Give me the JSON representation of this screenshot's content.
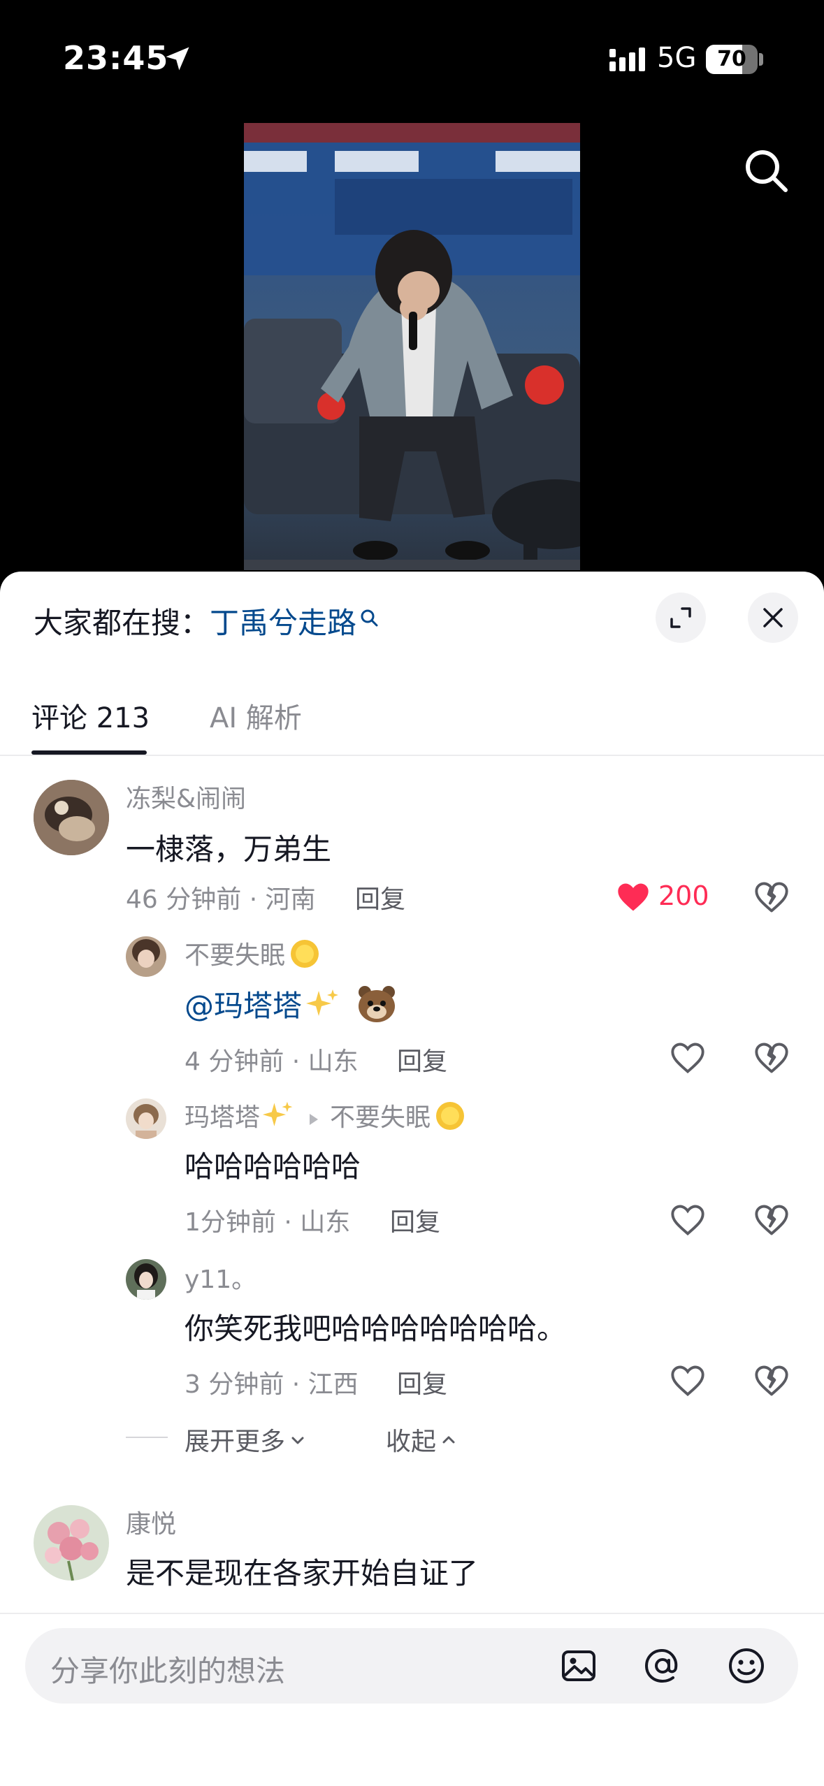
{
  "status_bar": {
    "time": "23:45",
    "network": "5G",
    "battery": "70",
    "battery_level": 0.7
  },
  "search_suggest": {
    "prefix": "大家都在搜：",
    "keyword": "丁禹兮走路"
  },
  "tabs": {
    "comments": "评论 213",
    "ai": "AI 解析"
  },
  "comments": [
    {
      "user": "冻梨&闹闹",
      "text": "一棣落，万弟生",
      "meta": "46 分钟前 · 河南",
      "reply": "回复",
      "likes": "200",
      "liked": true
    },
    {
      "user": "康悦",
      "text": "是不是现在各家开始自证了"
    }
  ],
  "replies": [
    {
      "user": "不要失眠",
      "mention": "@玛塔塔",
      "meta": "4 分钟前 · 山东",
      "reply": "回复"
    },
    {
      "user": "玛塔塔",
      "reply_to": "不要失眠",
      "text": "哈哈哈哈哈哈",
      "meta": "1分钟前 · 山东",
      "reply": "回复"
    },
    {
      "user": "y11。",
      "text": "你笑死我吧哈哈哈哈哈哈哈。",
      "meta": "3 分钟前 · 江西",
      "reply": "回复"
    }
  ],
  "thread_controls": {
    "expand_more": "展开更多",
    "collapse": "收起"
  },
  "input": {
    "placeholder": "分享你此刻的想法"
  },
  "colors": {
    "link": "#04498d",
    "like": "#fe2c55",
    "text": "#161823",
    "muted": "#8a8b91"
  },
  "icons": [
    "location-arrow-icon",
    "signal-icon",
    "search-icon",
    "fullscreen-icon",
    "close-icon",
    "heart-icon",
    "broken-heart-icon",
    "image-icon",
    "at-icon",
    "emoji-icon"
  ]
}
